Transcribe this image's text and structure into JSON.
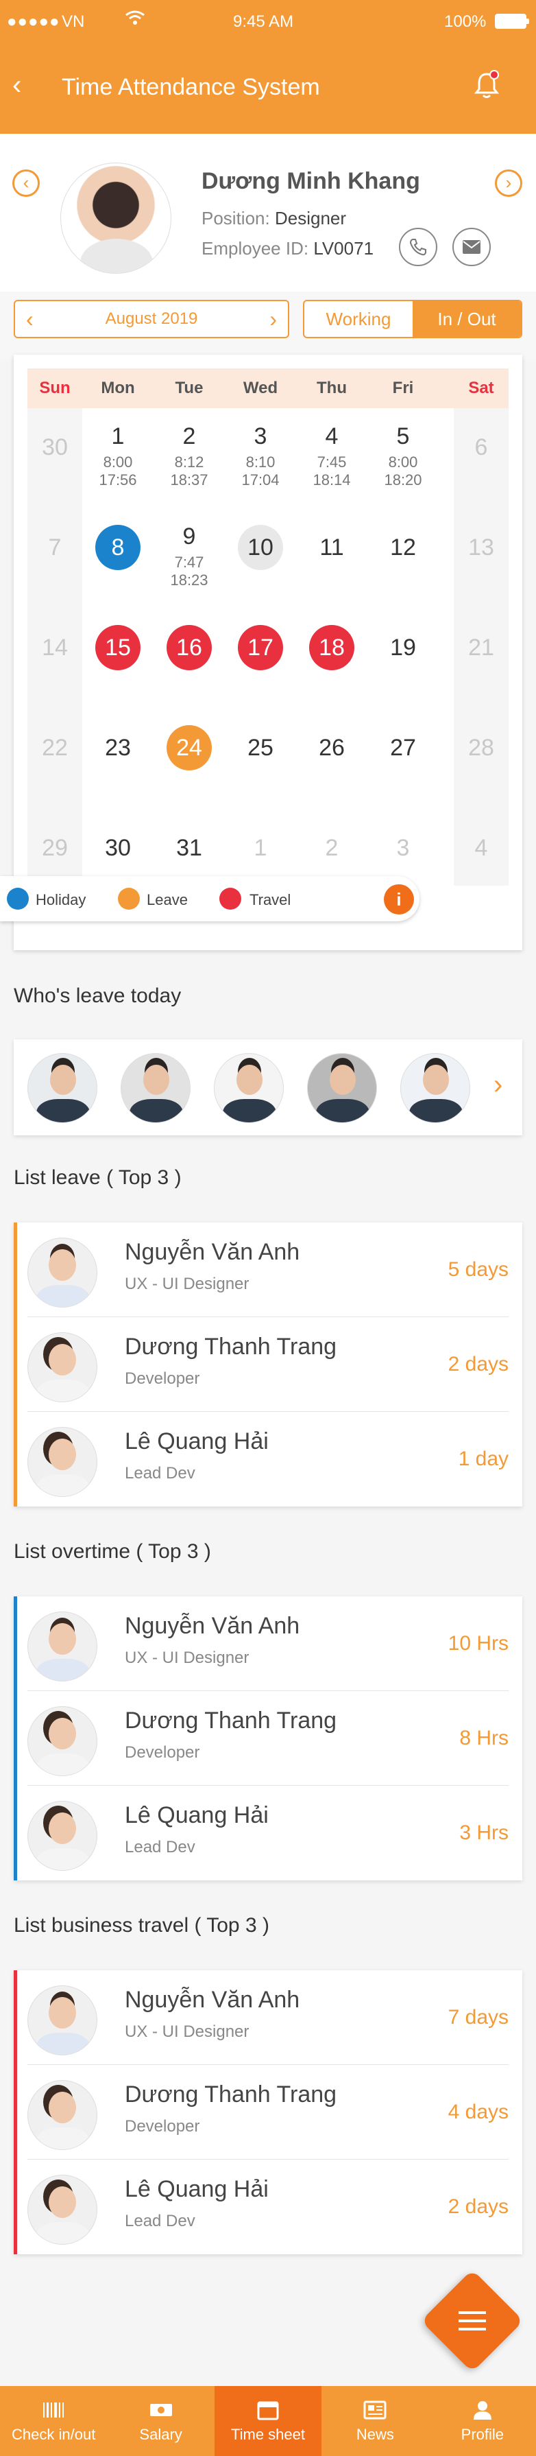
{
  "status_bar": {
    "signal": "●●●●●",
    "carrier": "VN",
    "time": "9:45 AM",
    "battery": "100%"
  },
  "header": {
    "title": "Time Attendance System"
  },
  "profile": {
    "name": "Dương Minh Khang",
    "position_label": "Position:",
    "position": "Designer",
    "employee_id_label": "Employee ID:",
    "employee_id": "LV0071"
  },
  "filters": {
    "month": "August 2019",
    "tabs": [
      "Working",
      "In / Out"
    ],
    "active_tab": "In / Out"
  },
  "calendar": {
    "weekdays": [
      "Sun",
      "Mon",
      "Tue",
      "Wed",
      "Thu",
      "Fri",
      "Sat"
    ],
    "weeks": [
      [
        {
          "d": "30",
          "muted": true
        },
        {
          "d": "1",
          "t1": "8:00",
          "t2": "17:56"
        },
        {
          "d": "2",
          "t1": "8:12",
          "t2": "18:37"
        },
        {
          "d": "3",
          "t1": "8:10",
          "t2": "17:04"
        },
        {
          "d": "4",
          "t1": "7:45",
          "t2": "18:14"
        },
        {
          "d": "5",
          "t1": "8:00",
          "t2": "18:20"
        },
        {
          "d": "6",
          "muted": true
        }
      ],
      [
        {
          "d": "7",
          "muted": true
        },
        {
          "d": "8",
          "mark": "blue"
        },
        {
          "d": "9",
          "t1": "7:47",
          "t2": "18:23"
        },
        {
          "d": "10",
          "mark": "gray"
        },
        {
          "d": "11"
        },
        {
          "d": "12"
        },
        {
          "d": "13",
          "muted": true
        }
      ],
      [
        {
          "d": "14",
          "muted": true
        },
        {
          "d": "15",
          "mark": "red"
        },
        {
          "d": "16",
          "mark": "red"
        },
        {
          "d": "17",
          "mark": "red"
        },
        {
          "d": "18",
          "mark": "red"
        },
        {
          "d": "19"
        },
        {
          "d": "21",
          "muted": true
        }
      ],
      [
        {
          "d": "22",
          "muted": true
        },
        {
          "d": "23"
        },
        {
          "d": "24",
          "mark": "orange"
        },
        {
          "d": "25"
        },
        {
          "d": "26"
        },
        {
          "d": "27"
        },
        {
          "d": "28",
          "muted": true
        }
      ],
      [
        {
          "d": "29",
          "muted": true
        },
        {
          "d": "30"
        },
        {
          "d": "31"
        },
        {
          "d": "1",
          "muted": true
        },
        {
          "d": "2",
          "muted": true
        },
        {
          "d": "3",
          "muted": true
        },
        {
          "d": "4",
          "muted": true
        }
      ]
    ],
    "legend": [
      {
        "label": "Holiday",
        "color": "#1a83cc"
      },
      {
        "label": "Leave",
        "color": "#f39a36"
      },
      {
        "label": "Travel",
        "color": "#e8303f"
      }
    ],
    "info": "i"
  },
  "leave_today": {
    "title": "Who's leave today"
  },
  "lists": [
    {
      "title": "List leave ( Top 3 )",
      "accent": "#f39a36",
      "rows": [
        {
          "name": "Nguyễn Văn Anh",
          "role": "UX - UI Designer",
          "value": "5 days",
          "gender": "m"
        },
        {
          "name": "Dương Thanh Trang",
          "role": "Developer",
          "value": "2 days",
          "gender": "f"
        },
        {
          "name": "Lê Quang Hải",
          "role": "Lead Dev",
          "value": "1 day",
          "gender": "f"
        }
      ]
    },
    {
      "title": "List overtime ( Top 3 )",
      "accent": "#1a83cc",
      "rows": [
        {
          "name": "Nguyễn Văn Anh",
          "role": "UX - UI Designer",
          "value": "10 Hrs",
          "gender": "m"
        },
        {
          "name": "Dương Thanh Trang",
          "role": "Developer",
          "value": "8 Hrs",
          "gender": "f"
        },
        {
          "name": "Lê Quang Hải",
          "role": "Lead Dev",
          "value": "3 Hrs",
          "gender": "f"
        }
      ]
    },
    {
      "title": "List business travel ( Top 3 )",
      "accent": "#e8303f",
      "rows": [
        {
          "name": "Nguyễn Văn Anh",
          "role": "UX - UI Designer",
          "value": "7 days",
          "gender": "m"
        },
        {
          "name": "Dương Thanh Trang",
          "role": "Developer",
          "value": "4 days",
          "gender": "f"
        },
        {
          "name": "Lê Quang Hải",
          "role": "Lead Dev",
          "value": "2 days",
          "gender": "f"
        }
      ]
    }
  ],
  "tabbar": [
    {
      "label": "Check in/out",
      "icon": "barcode-icon"
    },
    {
      "label": "Salary",
      "icon": "money-icon"
    },
    {
      "label": "Time sheet",
      "icon": "calendar-icon",
      "active": true
    },
    {
      "label": "News",
      "icon": "newspaper-icon"
    },
    {
      "label": "Profile",
      "icon": "user-icon"
    }
  ],
  "colors": {
    "primary": "#f39a36",
    "accent_dark": "#f06d1a",
    "holiday": "#1a83cc",
    "travel": "#e8303f"
  }
}
